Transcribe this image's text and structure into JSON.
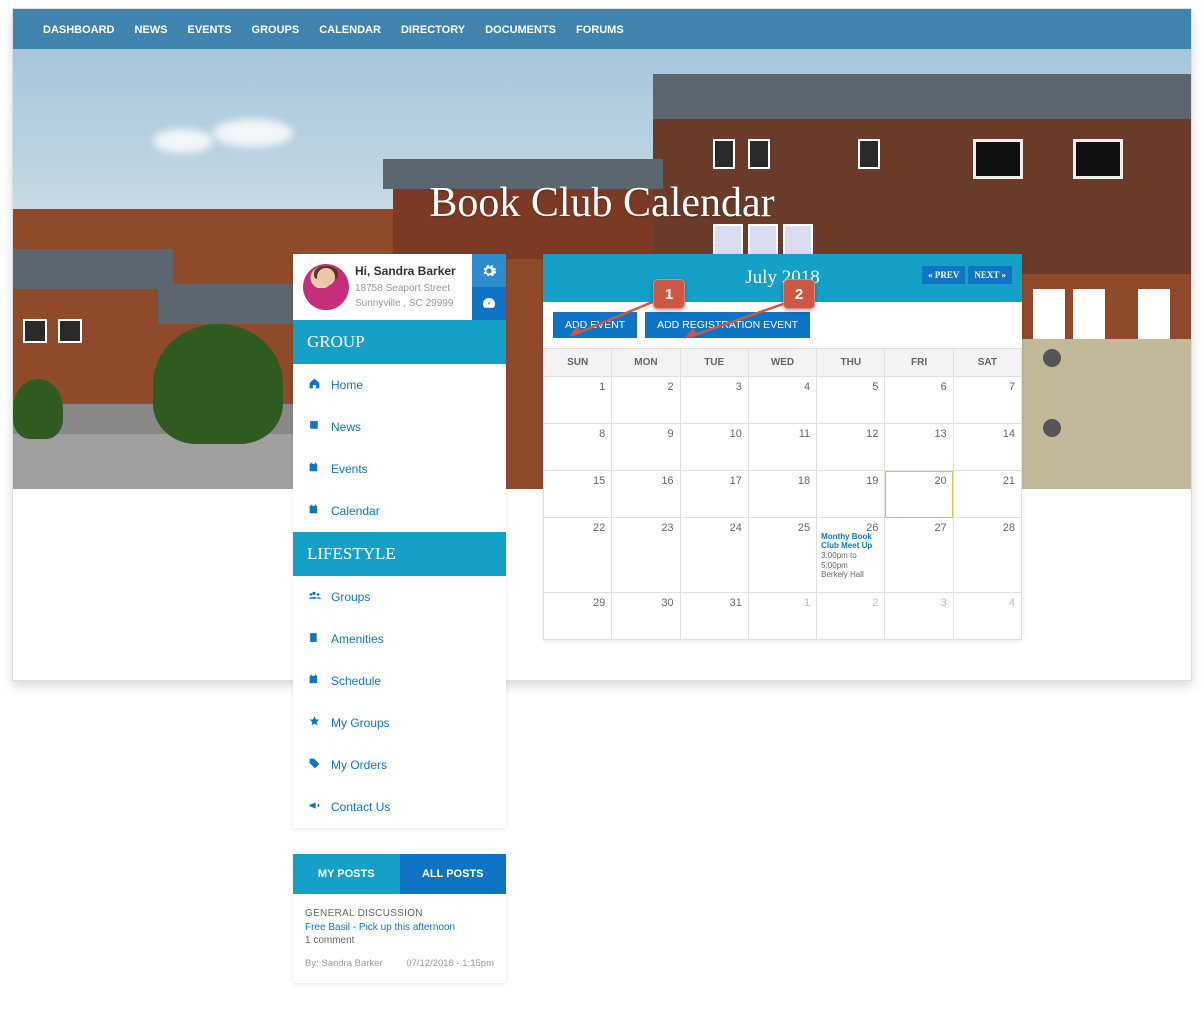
{
  "topnav": [
    "DASHBOARD",
    "NEWS",
    "EVENTS",
    "GROUPS",
    "CALENDAR",
    "DIRECTORY",
    "DOCUMENTS",
    "FORUMS"
  ],
  "page_title": "Book Club Calendar",
  "profile": {
    "greeting": "Hi, Sandra Barker",
    "address_line1": "18758 Seaport Street",
    "address_line2": "Sunnyville , SC 29999"
  },
  "sidebar": {
    "group_title": "GROUP",
    "group_items": [
      {
        "icon": "home",
        "label": "Home"
      },
      {
        "icon": "news",
        "label": "News"
      },
      {
        "icon": "events",
        "label": "Events"
      },
      {
        "icon": "calendar",
        "label": "Calendar"
      }
    ],
    "lifestyle_title": "LIFESTYLE",
    "lifestyle_items": [
      {
        "icon": "groups",
        "label": "Groups"
      },
      {
        "icon": "amenities",
        "label": "Amenities"
      },
      {
        "icon": "schedule",
        "label": "Schedule"
      },
      {
        "icon": "star",
        "label": "My Groups"
      },
      {
        "icon": "tag",
        "label": "My Orders"
      },
      {
        "icon": "bullhorn",
        "label": "Contact Us"
      }
    ]
  },
  "posts": {
    "tab_my": "MY POSTS",
    "tab_all": "ALL POSTS",
    "category": "GENERAL DISCUSSION",
    "title": "Free Basil - Pick up this afternoon",
    "comments": "1 comment",
    "by": "By: Sandra Barker",
    "date": "07/12/2018 - 1:15pm"
  },
  "calendar": {
    "title": "July 2018",
    "prev": "« PREV",
    "next": "NEXT »",
    "add_event": "ADD EVENT",
    "add_reg_event": "ADD REGISTRATION EVENT",
    "day_headers": [
      "SUN",
      "MON",
      "TUE",
      "WED",
      "THU",
      "FRI",
      "SAT"
    ],
    "weeks": [
      [
        {
          "n": "1"
        },
        {
          "n": "2"
        },
        {
          "n": "3"
        },
        {
          "n": "4"
        },
        {
          "n": "5"
        },
        {
          "n": "6"
        },
        {
          "n": "7"
        }
      ],
      [
        {
          "n": "8"
        },
        {
          "n": "9"
        },
        {
          "n": "10"
        },
        {
          "n": "11"
        },
        {
          "n": "12"
        },
        {
          "n": "13"
        },
        {
          "n": "14"
        }
      ],
      [
        {
          "n": "15"
        },
        {
          "n": "16"
        },
        {
          "n": "17"
        },
        {
          "n": "18"
        },
        {
          "n": "19"
        },
        {
          "n": "20",
          "today": true
        },
        {
          "n": "21"
        }
      ],
      [
        {
          "n": "22"
        },
        {
          "n": "23"
        },
        {
          "n": "24"
        },
        {
          "n": "25"
        },
        {
          "n": "26",
          "event": {
            "title": "Monthy Book Club Meet Up",
            "time": "3:00pm to 5:00pm",
            "loc": "Berkely Hall"
          }
        },
        {
          "n": "27"
        },
        {
          "n": "28"
        }
      ],
      [
        {
          "n": "29"
        },
        {
          "n": "30"
        },
        {
          "n": "31"
        },
        {
          "n": "1",
          "other": true
        },
        {
          "n": "2",
          "other": true
        },
        {
          "n": "3",
          "other": true
        },
        {
          "n": "4",
          "other": true
        }
      ]
    ]
  },
  "callouts": {
    "one": "1",
    "two": "2"
  }
}
